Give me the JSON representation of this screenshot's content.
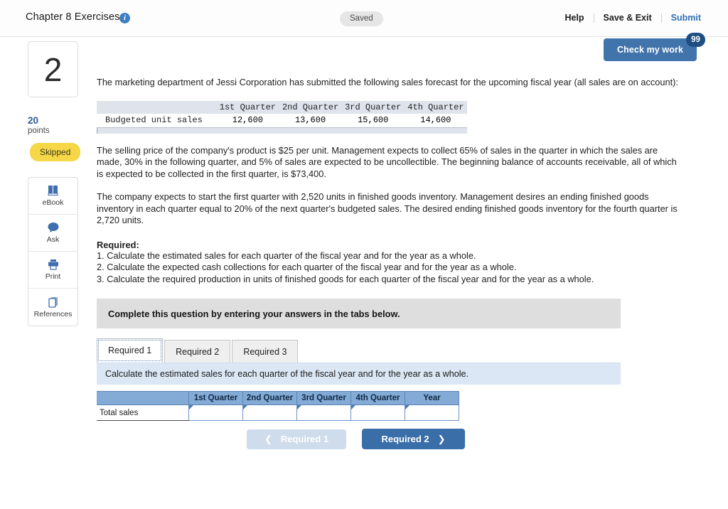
{
  "header": {
    "title": "Chapter 8 Exercises",
    "info_icon": "info-icon",
    "status_pill": "Saved",
    "links": [
      {
        "label": "Help",
        "style": "dark"
      },
      {
        "label": "Save & Exit",
        "style": "dark"
      },
      {
        "label": "Submit",
        "style": "blue"
      }
    ]
  },
  "check_work": {
    "label": "Check my work",
    "badge": "99"
  },
  "question_rail": {
    "number": "2",
    "points_value": "20",
    "points_label": "points",
    "status_badge": "Skipped",
    "tools": [
      {
        "label": "eBook",
        "icon": "book-icon"
      },
      {
        "label": "Ask",
        "icon": "chat-bubble-icon"
      },
      {
        "label": "Print",
        "icon": "printer-icon"
      },
      {
        "label": "References",
        "icon": "copy-pages-icon"
      }
    ]
  },
  "body": {
    "intro": "The marketing department of Jessi Corporation has submitted the following sales forecast for the upcoming fiscal year (all sales are on account):",
    "forecast_table": {
      "row_label_header": "",
      "columns": [
        "1st Quarter",
        "2nd Quarter",
        "3rd Quarter",
        "4th Quarter"
      ],
      "rows": [
        {
          "label": "Budgeted unit sales",
          "values": [
            "12,600",
            "13,600",
            "15,600",
            "14,600"
          ]
        }
      ]
    },
    "paragraph_2": "The selling price of the company's product is $25 per unit. Management expects to collect 65% of sales in the quarter in which the sales are made, 30% in the following quarter, and 5% of sales are expected to be uncollectible. The beginning balance of accounts receivable, all of which is expected to be collected in the first quarter, is $73,400.",
    "paragraph_3": "The company expects to start the first quarter with 2,520 units in finished goods inventory. Management desires an ending finished goods inventory in each quarter equal to 20% of the next quarter's budgeted sales. The desired ending finished goods inventory for the fourth quarter is 2,720 units.",
    "required_heading": "Required:",
    "required_items": [
      "1. Calculate the estimated sales for each quarter of the fiscal year and for the year as a whole.",
      "2. Calculate the expected cash collections for each quarter of the fiscal year and for the year as a whole.",
      "3. Calculate the required production in units of finished goods for each quarter of the fiscal year and for the year as a whole."
    ],
    "complete_bar": "Complete this question by entering your answers in the tabs below.",
    "tabs": [
      {
        "label": "Required 1",
        "active": true
      },
      {
        "label": "Required 2",
        "active": false
      },
      {
        "label": "Required 3",
        "active": false
      }
    ],
    "tab_instruction": "Calculate the estimated sales for each quarter of the fiscal year and for the year as a whole.",
    "answer_table": {
      "corner_header": "",
      "columns": [
        "1st Quarter",
        "2nd Quarter",
        "3rd Quarter",
        "4th Quarter",
        "Year"
      ],
      "rows": [
        {
          "label": "Total sales",
          "values": [
            "",
            "",
            "",
            "",
            ""
          ]
        }
      ]
    },
    "nav": {
      "prev_label": "Required 1",
      "prev_icon": "chevron-left-icon",
      "next_label": "Required 2",
      "next_icon": "chevron-right-icon"
    }
  }
}
